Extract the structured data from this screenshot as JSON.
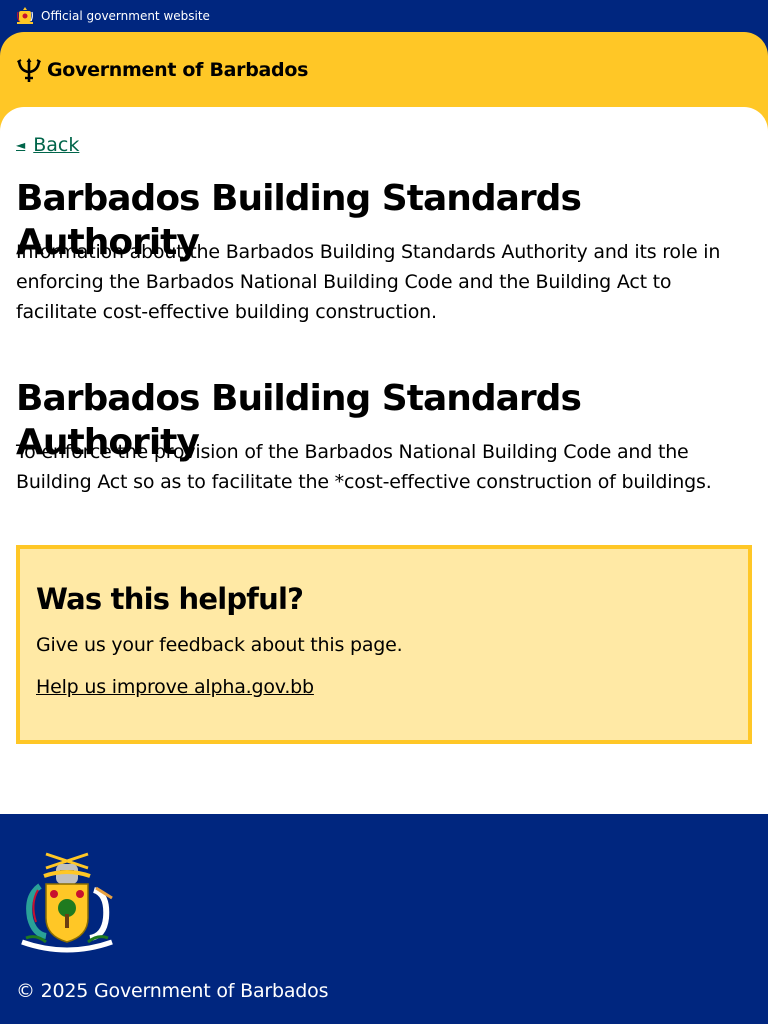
{
  "topbar": {
    "text": "Official government website"
  },
  "header": {
    "brand": "Government of Barbados"
  },
  "nav": {
    "back_label": "Back"
  },
  "page": {
    "title": "Barbados Building Standards Authority",
    "intro": "Information about the Barbados Building Standards Authority and its role in enforcing the Barbados National Building Code and the Building Act to facilitate cost-effective building construction.",
    "section_heading": "Barbados Building Standards Authority",
    "section_body": "To enforce the provision of the Barbados National Building Code and the Building Act so as to facilitate the *cost-effective construction of buildings."
  },
  "feedback": {
    "title": "Was this helpful?",
    "text": "Give us your feedback about this page.",
    "link": "Help us improve alpha.gov.bb"
  },
  "footer": {
    "copyright": "© 2025 Government of Barbados"
  },
  "colors": {
    "navy": "#00267f",
    "gold": "#ffc726",
    "feedback_bg": "#ffe9a5",
    "link_green": "#00654a"
  }
}
